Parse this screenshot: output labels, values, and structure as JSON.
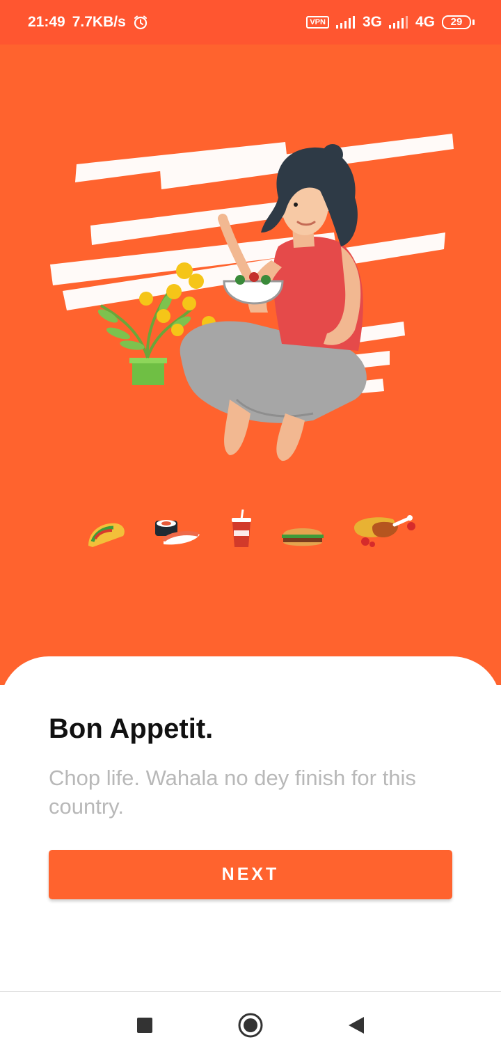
{
  "status_bar": {
    "time": "21:49",
    "network_speed": "7.7KB/s",
    "vpn_label": "VPN",
    "network_1": "3G",
    "network_2": "4G",
    "battery_level": "29",
    "icons": [
      "alarm-icon",
      "signal-icon",
      "battery-icon"
    ]
  },
  "hero": {
    "illustration": "woman-eating-salad-illustration",
    "food_icons": [
      "taco-icon",
      "sushi-icon",
      "soda-cup-icon",
      "burger-icon",
      "chicken-drumstick-icon"
    ]
  },
  "onboarding": {
    "title": "Bon Appetit.",
    "subtitle": "Chop life. Wahala no dey finish for this country.",
    "next_label": "NEXT"
  },
  "nav_bar": {
    "buttons": [
      "recents-square-icon",
      "home-circle-icon",
      "back-triangle-icon"
    ]
  },
  "colors": {
    "status_bar": "#ff5630",
    "accent": "#ff632e",
    "title": "#111111",
    "subtitle": "#b8b8b8"
  }
}
